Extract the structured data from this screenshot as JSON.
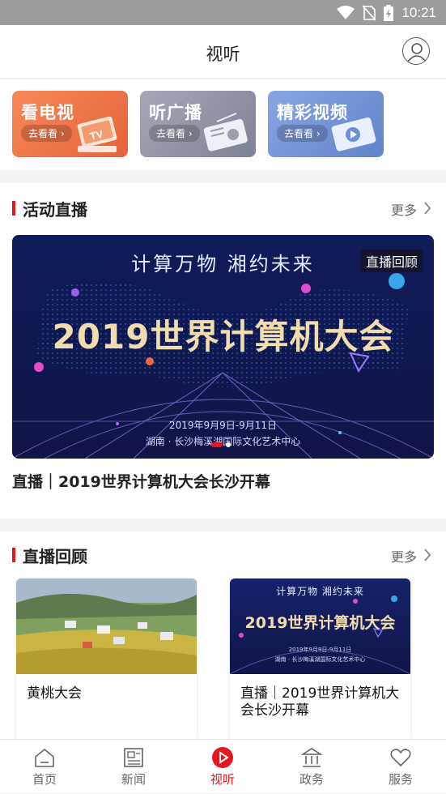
{
  "status_bar": {
    "time": "10:21",
    "icons": [
      "wifi-icon",
      "no-sim-icon",
      "battery-charging-icon"
    ]
  },
  "header": {
    "title": "视听",
    "avatar_icon": "user-icon"
  },
  "quick_entries": [
    {
      "title": "看电视",
      "button": "去看看 ›",
      "icon": "tv-icon"
    },
    {
      "title": "听广播",
      "button": "去看看 ›",
      "icon": "radio-icon"
    },
    {
      "title": "精彩视频",
      "button": "去看看 ›",
      "icon": "video-icon"
    }
  ],
  "live_section": {
    "title": "活动直播",
    "more": "更多",
    "banner": {
      "tag": "直播回顾",
      "slogan": "计算万物 湘约未来",
      "headline": "2019世界计算机大会",
      "date": "2019年9月9日-9月11日",
      "venue": "湖南 · 长沙梅溪湖国际文化艺术中心"
    },
    "caption": "直播｜2019世界计算机大会长沙开幕"
  },
  "replay_section": {
    "title": "直播回顾",
    "more": "更多",
    "cards": [
      {
        "title": "黄桃大会"
      },
      {
        "title": "直播｜2019世界计算机大会长沙开幕",
        "thumb_slogan": "计算万物 湘约未来",
        "thumb_headline": "2019世界计算机大会",
        "thumb_date": "2019年9月9日-9月11日",
        "thumb_venue": "湖南 · 长沙梅溪湖国际文化艺术中心"
      }
    ]
  },
  "tabbar": [
    {
      "label": "首页",
      "icon": "home-icon",
      "active": false
    },
    {
      "label": "新闻",
      "icon": "news-icon",
      "active": false
    },
    {
      "label": "视听",
      "icon": "play-icon",
      "active": true
    },
    {
      "label": "政务",
      "icon": "government-icon",
      "active": false
    },
    {
      "label": "服务",
      "icon": "heart-icon",
      "active": false
    }
  ],
  "colors": {
    "accent": "#e4161e",
    "status_bar": "#9c9c9c"
  }
}
